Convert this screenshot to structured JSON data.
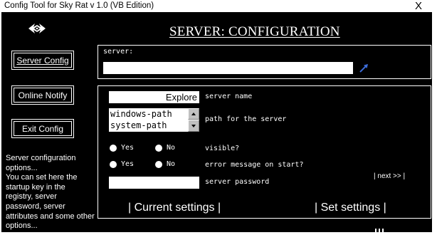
{
  "window": {
    "title": "Config Tool for Sky Rat v 1.0 (VB Edition)",
    "close_glyph": "X"
  },
  "page_title": "SERVER: CONFIGURATION",
  "nav": {
    "server_config": "Server Config",
    "online_notify": "Online Notify",
    "exit_config": "Exit Config"
  },
  "help_text": "Server configuration options...\nYou can set here the startup key in the registry, server password, server attributes and some other options...",
  "server_section": {
    "label": "server:",
    "value": "",
    "browse_icon": "arrow-icon"
  },
  "settings": {
    "server_name_value": "Explore",
    "server_name_label": "server name",
    "path_options": [
      "windows-path",
      "system-path"
    ],
    "path_label": "path for the server",
    "visible_label": "visible?",
    "error_msg_label": "error message on start?",
    "yes_label": "Yes",
    "no_label": "No",
    "password_label": "server password",
    "password_value": "",
    "next_label": "| next >> |",
    "current_settings": "| Current settings |",
    "set_settings": "| Set settings |"
  },
  "colors": {
    "background": "#000000",
    "foreground": "#ffffff",
    "accent": "#3c6cd8"
  }
}
